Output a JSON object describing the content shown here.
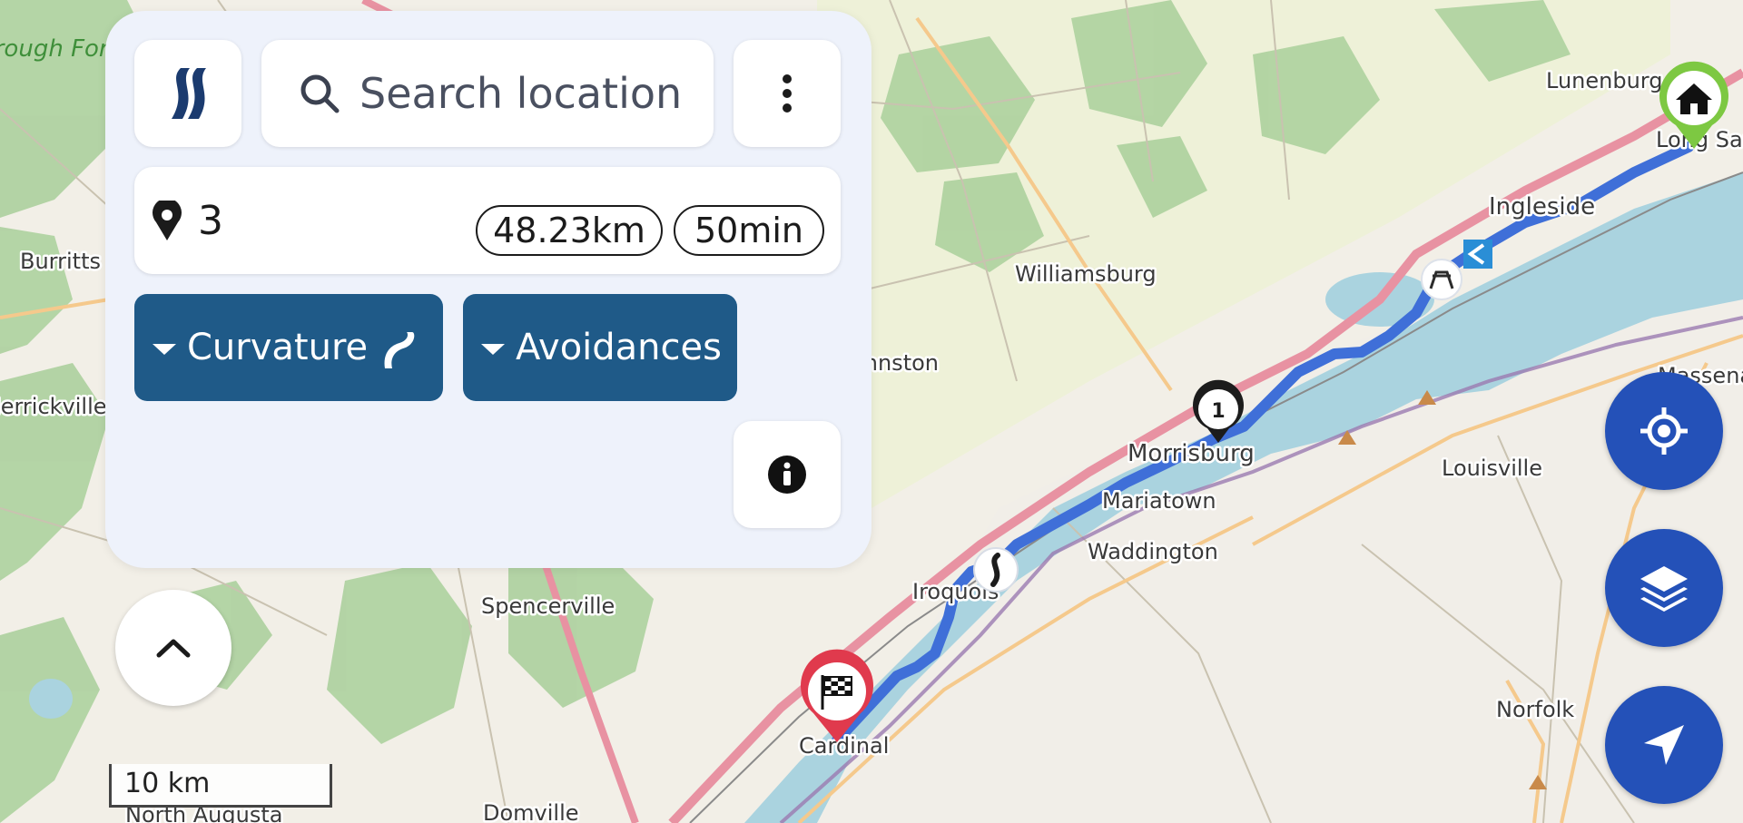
{
  "map": {
    "places": [
      {
        "name": "Lunenburg"
      },
      {
        "name": "Long Sault"
      },
      {
        "name": "Ingleside"
      },
      {
        "name": "Williamsburg"
      },
      {
        "name": "Morrisburg"
      },
      {
        "name": "Mariatown"
      },
      {
        "name": "Waddington"
      },
      {
        "name": "Louisville"
      },
      {
        "name": "Iroquois"
      },
      {
        "name": "Spencerville"
      },
      {
        "name": "Cardinal"
      },
      {
        "name": "Burritts"
      },
      {
        "name": "Merrickville"
      },
      {
        "name": "Norfolk"
      },
      {
        "name": "Massena"
      },
      {
        "name": "Domville"
      },
      {
        "name": "North Augusta"
      },
      {
        "name": "Johnston"
      },
      {
        "name": "Borough Forest"
      }
    ],
    "waypoint_number": "1",
    "route_color": "#3f6fd8",
    "start_marker": "home-icon",
    "end_marker": "checkered-flag-icon"
  },
  "panel": {
    "search_placeholder": "Search location",
    "waypoint_count": "3",
    "distance": "48.23km",
    "duration": "50min",
    "curvature_label": "Curvature",
    "avoidances_label": "Avoidances"
  },
  "scale_bar": {
    "label": "10 km"
  },
  "colors": {
    "panel_bg": "#eef2fb",
    "dark_button": "#1f5a88",
    "fab": "#2451b8",
    "water": "#aad3df",
    "forest": "#add19e",
    "motorway": "#e892a2"
  }
}
